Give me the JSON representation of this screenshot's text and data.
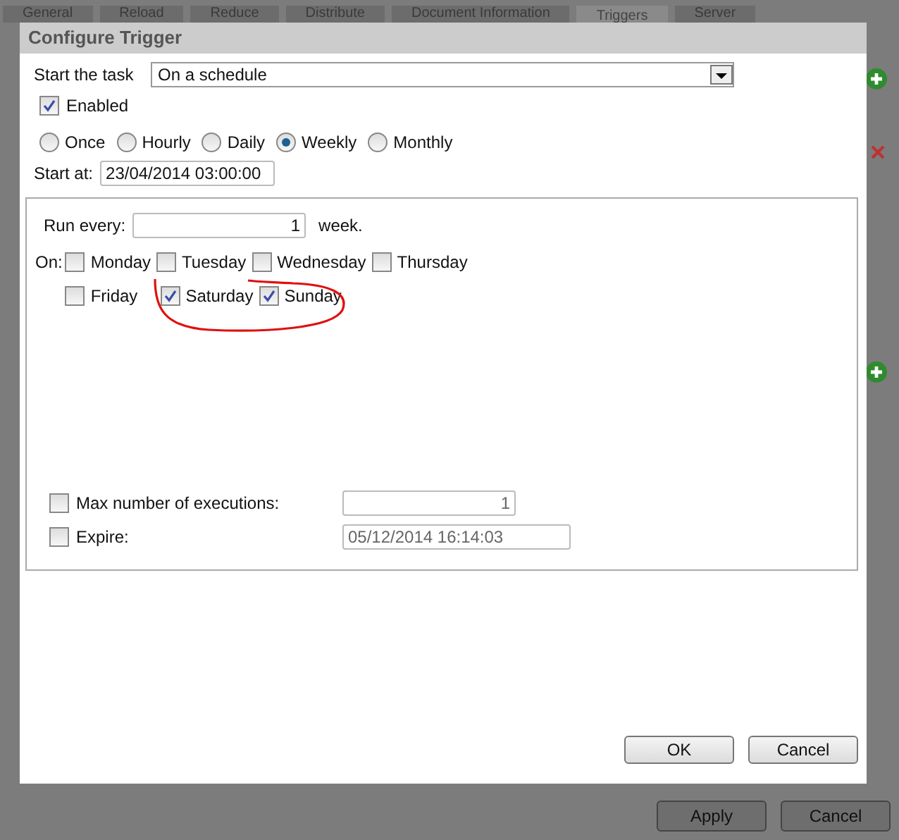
{
  "background": {
    "tabs": [
      {
        "label": "General",
        "selected": false
      },
      {
        "label": "Reload",
        "selected": false
      },
      {
        "label": "Reduce",
        "selected": false
      },
      {
        "label": "Distribute",
        "selected": false
      },
      {
        "label": "Document Information",
        "selected": false
      },
      {
        "label": "Triggers",
        "selected": true
      },
      {
        "label": "Server",
        "selected": false
      }
    ],
    "buttons": [
      "Apply",
      "Cancel"
    ]
  },
  "dialog": {
    "title": "Configure Trigger",
    "start_task": {
      "label": "Start the task",
      "value": "On a schedule"
    },
    "enabled": {
      "label": "Enabled",
      "checked": true
    },
    "frequency": [
      {
        "label": "Once",
        "selected": false
      },
      {
        "label": "Hourly",
        "selected": false
      },
      {
        "label": "Daily",
        "selected": false
      },
      {
        "label": "Weekly",
        "selected": true
      },
      {
        "label": "Monthly",
        "selected": false
      }
    ],
    "start_at": {
      "label": "Start at:",
      "value": "23/04/2014 03:00:00"
    },
    "run_every": {
      "label": "Run every:",
      "value": "1",
      "unit": "week."
    },
    "on_label": "On:",
    "days": [
      {
        "label": "Monday",
        "checked": false
      },
      {
        "label": "Tuesday",
        "checked": false
      },
      {
        "label": "Wednesday",
        "checked": false
      },
      {
        "label": "Thursday",
        "checked": false
      },
      {
        "label": "Friday",
        "checked": false
      },
      {
        "label": "Saturday",
        "checked": true
      },
      {
        "label": "Sunday",
        "checked": true
      }
    ],
    "max_executions": {
      "label": "Max number of executions:",
      "checked": false,
      "value": "1"
    },
    "expire": {
      "label": "Expire:",
      "checked": false,
      "value": "05/12/2014 16:14:03"
    },
    "buttons": [
      "OK",
      "Cancel"
    ]
  }
}
